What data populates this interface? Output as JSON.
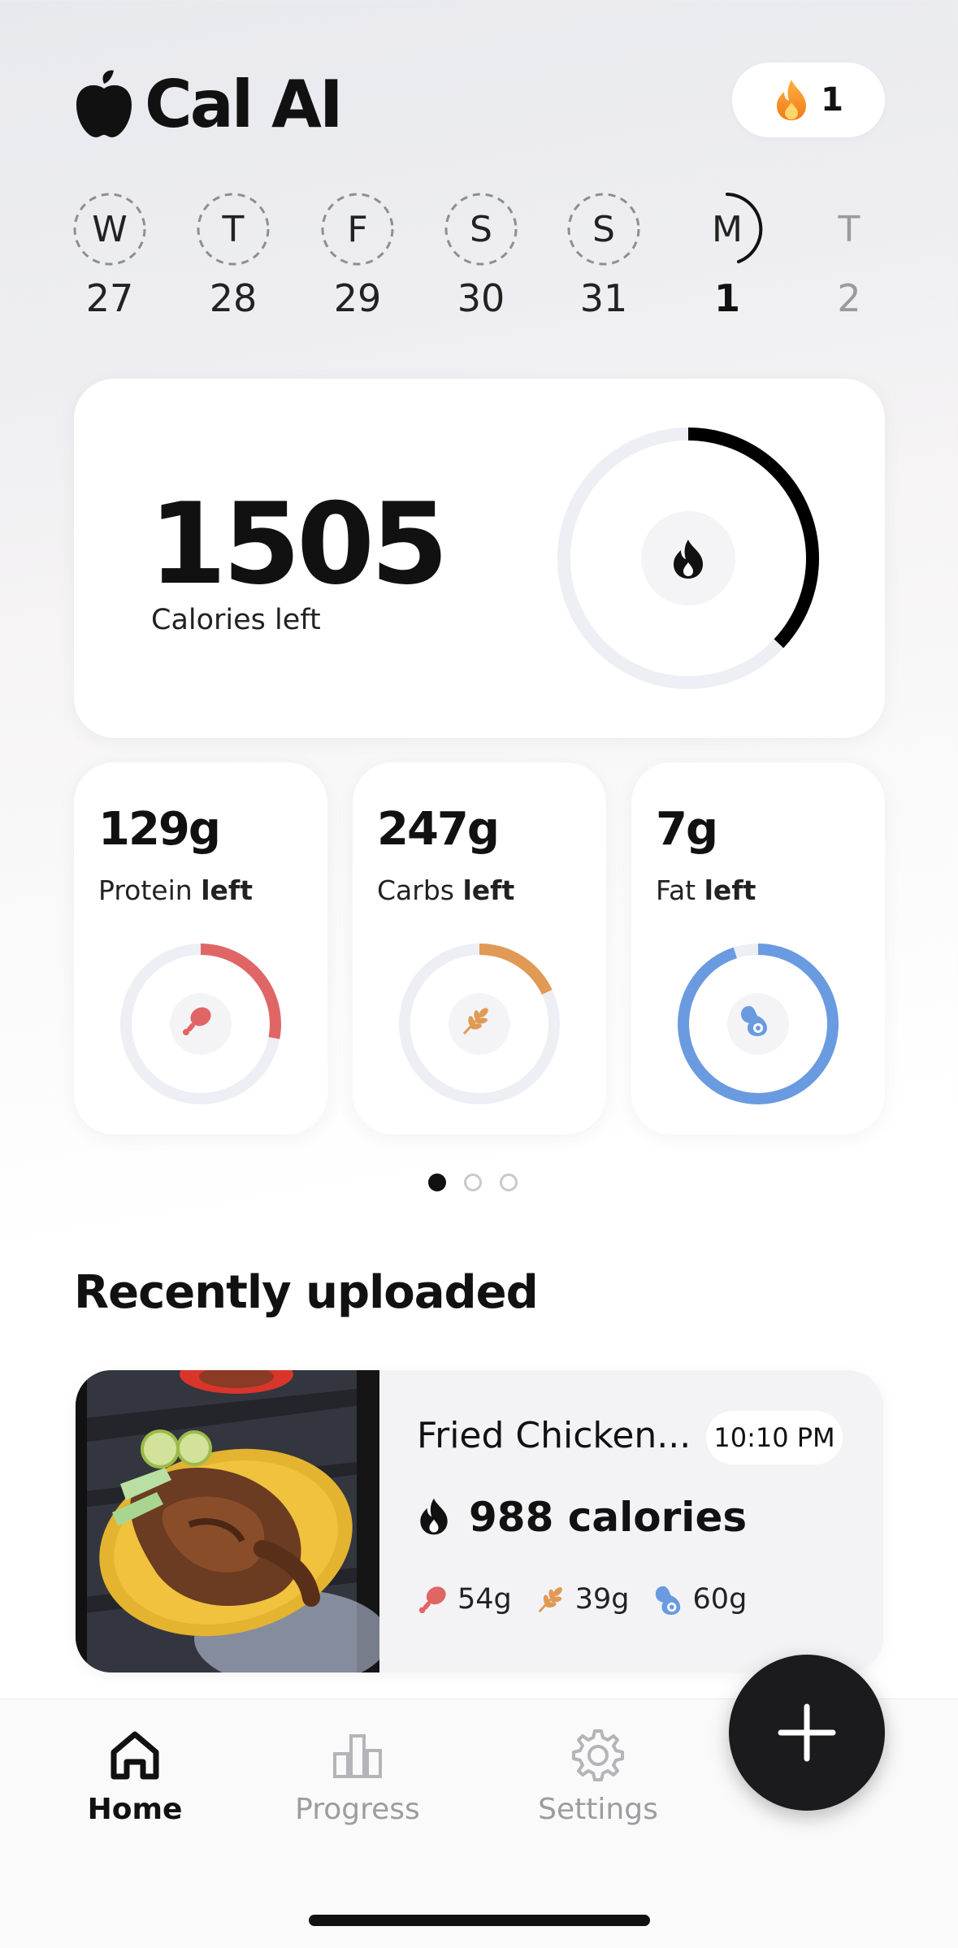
{
  "app": {
    "title": "Cal AI"
  },
  "streak": {
    "count": "1",
    "icon": "flame-icon"
  },
  "days": [
    {
      "letter": "W",
      "number": "27",
      "state": "past"
    },
    {
      "letter": "T",
      "number": "28",
      "state": "past"
    },
    {
      "letter": "F",
      "number": "29",
      "state": "past"
    },
    {
      "letter": "S",
      "number": "30",
      "state": "past"
    },
    {
      "letter": "S",
      "number": "31",
      "state": "past"
    },
    {
      "letter": "M",
      "number": "1",
      "state": "today"
    },
    {
      "letter": "T",
      "number": "2",
      "state": "future"
    }
  ],
  "calories": {
    "value": "1505",
    "label": "Calories left",
    "progress": 0.37,
    "icon": "flame-icon"
  },
  "macros": [
    {
      "value": "129g",
      "name": "Protein",
      "suffix": "left",
      "color": "#e06666",
      "progress": 0.28,
      "icon": "drumstick-icon"
    },
    {
      "value": "247g",
      "name": "Carbs",
      "suffix": "left",
      "color": "#e09a55",
      "progress": 0.18,
      "icon": "wheat-icon"
    },
    {
      "value": "7g",
      "name": "Fat",
      "suffix": "left",
      "color": "#6a9be0",
      "progress": 0.95,
      "icon": "avocado-icon"
    }
  ],
  "pager": {
    "total": 3,
    "active": 0
  },
  "recent": {
    "title": "Recently uploaded",
    "items": [
      {
        "name": "Fried Chicken...",
        "time": "10:10 PM",
        "calories": "988 calories",
        "protein": "54g",
        "carbs": "39g",
        "fat": "60g"
      }
    ]
  },
  "nav": {
    "home": "Home",
    "progress": "Progress",
    "settings": "Settings"
  },
  "colors": {
    "accent": "#111111",
    "ring_track": "#eeeff4",
    "protein": "#e06666",
    "carbs": "#e09a55",
    "fat": "#6a9be0"
  }
}
